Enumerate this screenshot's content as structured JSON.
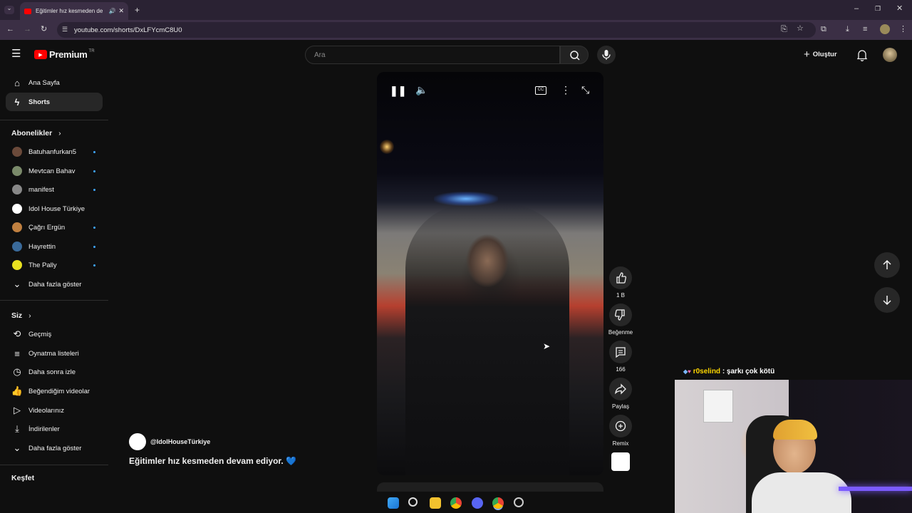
{
  "browser": {
    "tab_title": "Eğitimler hız kesmeden de",
    "url": "youtube.com/shorts/DxLFYcmC8U0"
  },
  "header": {
    "logo_text": "Premium",
    "logo_badge": "TR",
    "search_placeholder": "Ara",
    "create_label": "Oluştur"
  },
  "sidebar": {
    "main": [
      {
        "label": "Ana Sayfa",
        "icon": "home-icon"
      },
      {
        "label": "Shorts",
        "icon": "shorts-icon",
        "active": true
      }
    ],
    "subscriptions_title": "Abonelikler",
    "subscriptions": [
      {
        "label": "Batuhanfurkan5",
        "color": "#6b4a3a",
        "dot": true
      },
      {
        "label": "Mevtcan Bahav",
        "color": "#7a8a6a",
        "dot": true
      },
      {
        "label": "manifest",
        "color": "#888888",
        "dot": true
      },
      {
        "label": "Idol House Türkiye",
        "color": "#ffffff",
        "dot": false
      },
      {
        "label": "Çağrı Ergün",
        "color": "#c08040",
        "dot": true
      },
      {
        "label": "Hayrettin",
        "color": "#3a6a9a",
        "dot": true
      },
      {
        "label": "The Pally",
        "color": "#e8e020",
        "dot": true
      }
    ],
    "show_more_1": "Daha fazla göster",
    "you_title": "Siz",
    "you_items": [
      {
        "label": "Geçmiş",
        "icon": "history-icon"
      },
      {
        "label": "Oynatma listeleri",
        "icon": "playlist-icon"
      },
      {
        "label": "Daha sonra izle",
        "icon": "watch-later-icon"
      },
      {
        "label": "Beğendiğim videolar",
        "icon": "like-icon"
      },
      {
        "label": "Videolarınız",
        "icon": "your-videos-icon"
      },
      {
        "label": "İndirilenler",
        "icon": "download-icon"
      }
    ],
    "show_more_2": "Daha fazla göster",
    "explore_title": "Keşfet"
  },
  "short": {
    "channel": "@IdolHouseTürkiye",
    "caption": "Eğitimler hız kesmeden devam ediyor.",
    "caption_emoji": "💙",
    "likes": "1 B",
    "dislike_label": "Beğenme",
    "comments": "166",
    "share_label": "Paylaş",
    "remix_label": "Remix"
  },
  "stream_overlay": {
    "chat_user": "r0selind",
    "chat_message": ": şarkı çok kötü"
  },
  "colors": {
    "brand_red": "#ff0000",
    "background": "#0f0f0f",
    "browser_frame": "#3b2f45",
    "accent_blue": "#3ea6ff"
  }
}
